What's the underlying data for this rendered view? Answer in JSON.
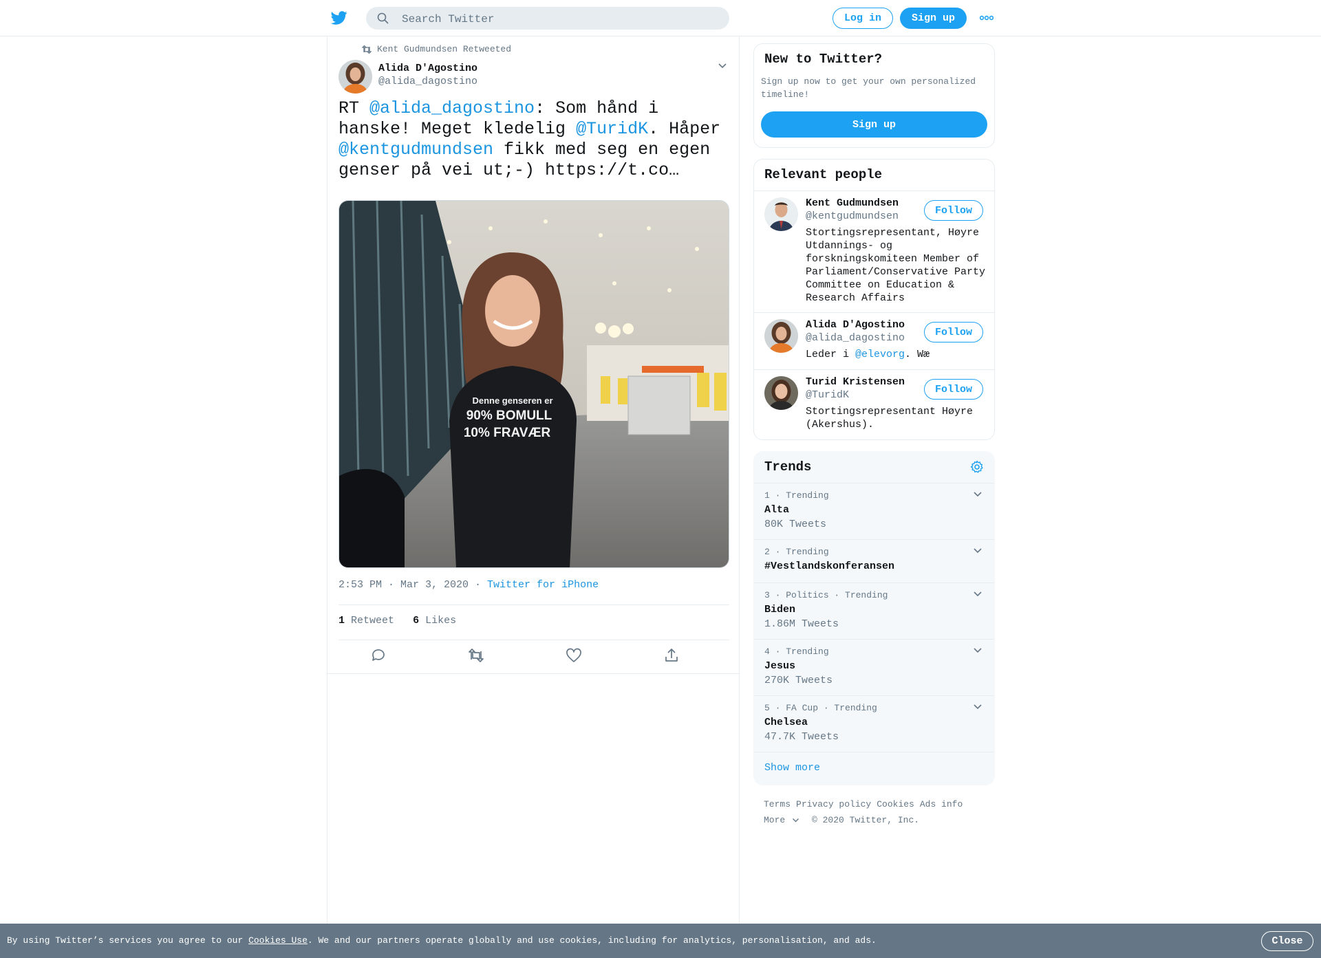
{
  "header": {
    "search_placeholder": "Search Twitter",
    "login_label": "Log in",
    "signup_label": "Sign up",
    "icons": {
      "logo": "twitter-bird-icon",
      "search": "search-icon",
      "more": "more-dots-icon"
    }
  },
  "tweet": {
    "retweeted_by": "Kent Gudmundsen Retweeted",
    "author_name": "Alida D'Agostino",
    "author_handle": "@alida_dagostino",
    "text_parts": {
      "p1": "RT ",
      "m1": "@alida_dagostino",
      "p2": ": Som hånd i hanske! Meget kledelig ",
      "m2": "@TuridK",
      "p3": ". Håper ",
      "m3": "@kentgudmundsen",
      "p4": " fikk med seg en egen genser på vei ut;-) https://t.co…"
    },
    "time": "2:53 PM · Mar 3, 2020",
    "separator": " · ",
    "source": "Twitter for iPhone",
    "retweet_count": "1",
    "retweet_label": "Retweet",
    "like_count": "6",
    "like_label": "Likes",
    "hoodie_text": [
      "Denne genseren er",
      "90% BOMULL",
      "10% FRAVÆR"
    ]
  },
  "new_to_twitter": {
    "title": "New to Twitter?",
    "subtitle": "Sign up now to get your own personalized timeline!",
    "signup_label": "Sign up"
  },
  "relevant_people": {
    "title": "Relevant people",
    "follow_label": "Follow",
    "people": [
      {
        "name": "Kent Gudmundsen",
        "handle": "@kentgudmundsen",
        "bio": "Stortingsrepresentant, Høyre Utdannings- og forskningskomiteen Member of Parliament/Conservative Party Committee on Education & Research Affairs"
      },
      {
        "name": "Alida D'Agostino",
        "handle": "@alida_dagostino",
        "bio_prefix": "Leder i ",
        "bio_mention": "@elevorg",
        "bio_suffix": ". Wæ"
      },
      {
        "name": "Turid Kristensen",
        "handle": "@TuridK",
        "bio": "Stortingsrepresentant Høyre (Akershus)."
      }
    ]
  },
  "trends": {
    "title": "Trends",
    "items": [
      {
        "meta": "1 · Trending",
        "name": "Alta",
        "count": "80K Tweets"
      },
      {
        "meta": "2 · Trending",
        "name": "#Vestlandskonferansen",
        "count": ""
      },
      {
        "meta": "3 · Politics · Trending",
        "name": "Biden",
        "count": "1.86M Tweets"
      },
      {
        "meta": "4 · Trending",
        "name": "Jesus",
        "count": "270K Tweets"
      },
      {
        "meta": "5 · FA Cup · Trending",
        "name": "Chelsea",
        "count": "47.7K Tweets"
      }
    ],
    "show_more": "Show more"
  },
  "footer": {
    "links": [
      "Terms",
      "Privacy policy",
      "Cookies",
      "Ads info"
    ],
    "more": "More",
    "copyright": "© 2020 Twitter, Inc."
  },
  "cookie_bar": {
    "text_before": "By using Twitter’s services you agree to our ",
    "link": "Cookies Use",
    "text_after": ". We and our partners operate globally and use cookies, including for analytics, personalisation, and ads.",
    "close_label": "Close"
  },
  "colors": {
    "accent": "#1da1f2",
    "link": "#1b95e0",
    "muted": "#657786",
    "cookie_bg": "#657786"
  }
}
